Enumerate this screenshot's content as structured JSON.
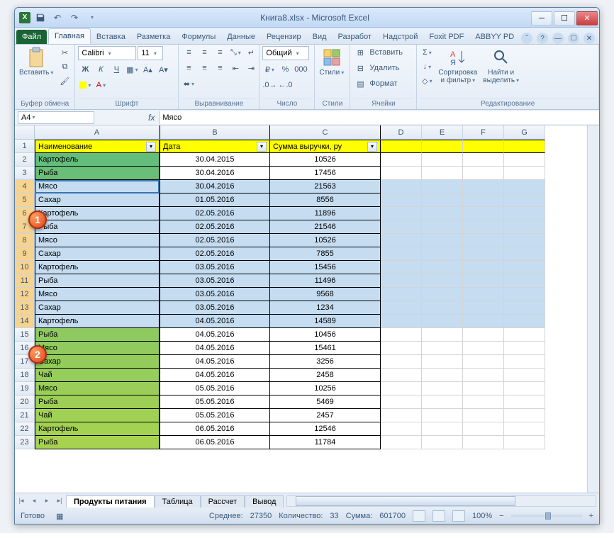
{
  "title": "Книга8.xlsx - Microsoft Excel",
  "qat": {
    "save": "💾",
    "undo": "↶",
    "redo": "↷"
  },
  "tabs": {
    "file": "Файл",
    "items": [
      "Главная",
      "Вставка",
      "Разметка",
      "Формулы",
      "Данные",
      "Рецензир",
      "Вид",
      "Разработ",
      "Надстрой",
      "Foxit PDF",
      "ABBYY PD"
    ],
    "active": 0
  },
  "ribbon": {
    "clipboard": {
      "paste": "Вставить",
      "label": "Буфер обмена"
    },
    "font": {
      "name": "Calibri",
      "size": "11",
      "label": "Шрифт",
      "bold": "Ж",
      "italic": "К",
      "underline": "Ч"
    },
    "align": {
      "label": "Выравнивание"
    },
    "number": {
      "format": "Общий",
      "label": "Число"
    },
    "styles": {
      "btn": "Стили",
      "label": "Стили"
    },
    "cells": {
      "insert": "Вставить",
      "delete": "Удалить",
      "format": "Формат",
      "label": "Ячейки"
    },
    "editing": {
      "sort": "Сортировка\nи фильтр",
      "find": "Найти и\nвыделить",
      "label": "Редактирование"
    }
  },
  "namebox": "A4",
  "formula": "Мясо",
  "fx_label": "fx",
  "columns": [
    "A",
    "B",
    "C",
    "D",
    "E",
    "F",
    "G"
  ],
  "headers": {
    "a": "Наименование",
    "b": "Дата",
    "c": "Сумма выручки, ру"
  },
  "rows": [
    {
      "n": 2,
      "a": "Картофель",
      "b": "30.04.2015",
      "c": "10526"
    },
    {
      "n": 3,
      "a": "Рыба",
      "b": "30.04.2016",
      "c": "17456"
    },
    {
      "n": 4,
      "a": "Мясо",
      "b": "30.04.2016",
      "c": "21563"
    },
    {
      "n": 5,
      "a": "Сахар",
      "b": "01.05.2016",
      "c": "8556"
    },
    {
      "n": 6,
      "a": "Картофель",
      "b": "02.05.2016",
      "c": "11896"
    },
    {
      "n": 7,
      "a": "Рыба",
      "b": "02.05.2016",
      "c": "21546"
    },
    {
      "n": 8,
      "a": "Мясо",
      "b": "02.05.2016",
      "c": "10526"
    },
    {
      "n": 9,
      "a": "Сахар",
      "b": "02.05.2016",
      "c": "7855"
    },
    {
      "n": 10,
      "a": "Картофель",
      "b": "03.05.2016",
      "c": "15456"
    },
    {
      "n": 11,
      "a": "Рыба",
      "b": "03.05.2016",
      "c": "11496"
    },
    {
      "n": 12,
      "a": "Мясо",
      "b": "03.05.2016",
      "c": "9568"
    },
    {
      "n": 13,
      "a": "Сахар",
      "b": "03.05.2016",
      "c": "1234"
    },
    {
      "n": 14,
      "a": "Картофель",
      "b": "04.05.2016",
      "c": "14589"
    },
    {
      "n": 15,
      "a": "Рыба",
      "b": "04.05.2016",
      "c": "10456"
    },
    {
      "n": 16,
      "a": "Мясо",
      "b": "04.05.2016",
      "c": "15461"
    },
    {
      "n": 17,
      "a": "Сахар",
      "b": "04.05.2016",
      "c": "3256"
    },
    {
      "n": 18,
      "a": "Чай",
      "b": "04.05.2016",
      "c": "2458"
    },
    {
      "n": 19,
      "a": "Мясо",
      "b": "05.05.2016",
      "c": "10256"
    },
    {
      "n": 20,
      "a": "Рыба",
      "b": "05.05.2016",
      "c": "5469"
    },
    {
      "n": 21,
      "a": "Чай",
      "b": "05.05.2016",
      "c": "2457"
    },
    {
      "n": 22,
      "a": "Картофель",
      "b": "06.05.2016",
      "c": "12546"
    },
    {
      "n": 23,
      "a": "Рыба",
      "b": "06.05.2016",
      "c": "11784"
    }
  ],
  "selected_from": 4,
  "selected_to": 14,
  "active_row": 4,
  "callouts": {
    "one": "1",
    "two": "2"
  },
  "sheets": {
    "active": "Продукты питания",
    "others": [
      "Таблица",
      "Рассчет",
      "Вывод"
    ]
  },
  "status": {
    "ready": "Готово",
    "avg_label": "Среднее:",
    "avg": "27350",
    "count_label": "Количество:",
    "count": "33",
    "sum_label": "Сумма:",
    "sum": "601700",
    "zoom": "100%"
  }
}
